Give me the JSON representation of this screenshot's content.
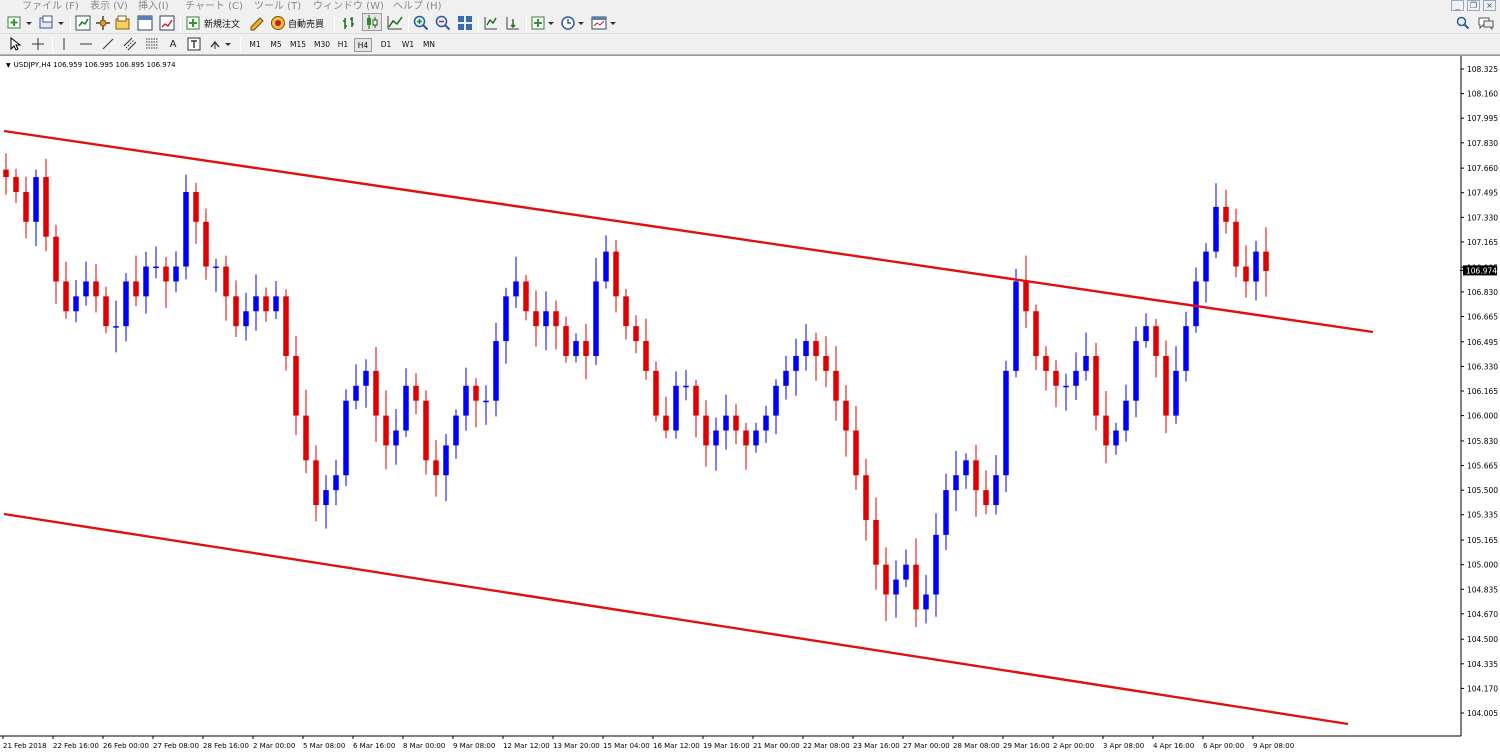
{
  "menu": {
    "items": [
      "ファイル (F)",
      "表示 (V)",
      "挿入(I)",
      "チャート (C)",
      "ツール (T)",
      "ウィンドウ (W)",
      "ヘルプ (H)"
    ]
  },
  "window_controls": [
    "_",
    "❐",
    "×"
  ],
  "toolbar": {
    "new_order_label": "新規注文",
    "auto_trading_label": "自動売買",
    "icons": [
      "new-chart-icon",
      "profiles-icon",
      "market-watch-icon",
      "navigator-icon",
      "data-window-icon",
      "terminal-icon",
      "strategy-tester-icon",
      "new-order-icon",
      "metaeditor-icon",
      "auto-trading-icon",
      "bar-chart-icon",
      "candlestick-icon",
      "line-chart-icon",
      "zoom-in-icon",
      "zoom-out-icon",
      "tile-windows-icon",
      "chart-shift-icon",
      "autoscroll-icon",
      "indicators-icon",
      "periods-icon",
      "templates-icon",
      "search-icon",
      "chat-icon"
    ]
  },
  "drawing_tools": {
    "icons": [
      "cursor-icon",
      "crosshair-icon",
      "vertical-line-icon",
      "horizontal-line-icon",
      "trendline-icon",
      "equidistant-channel-icon",
      "fibonacci-icon",
      "text-icon",
      "text-label-icon",
      "arrows-icon"
    ],
    "text_tool_label": "A"
  },
  "timeframes": {
    "items": [
      "M1",
      "M5",
      "M15",
      "M30",
      "H1",
      "H4",
      "D1",
      "W1",
      "MN"
    ],
    "active": "H4"
  },
  "chart_data": {
    "type": "candlestick",
    "symbol": "USDJPY,H4",
    "header": "USDJPY,H4  106.959 106.995 106.895 106.974",
    "ohlc": {
      "open": "106.959",
      "high": "106.995",
      "low": "106.895",
      "close": "106.974"
    },
    "current_price_label": "106.974",
    "price_ticks": [
      "108.325",
      "108.160",
      "107.995",
      "107.830",
      "107.660",
      "107.495",
      "107.330",
      "107.165",
      "106.995",
      "106.830",
      "106.665",
      "106.495",
      "106.330",
      "106.165",
      "106.000",
      "105.830",
      "105.665",
      "105.500",
      "105.335",
      "105.165",
      "105.000",
      "104.835",
      "104.670",
      "104.500",
      "104.335",
      "104.170",
      "104.005"
    ],
    "time_ticks": [
      "21 Feb 2018",
      "22 Feb 16:00",
      "26 Feb 00:00",
      "27 Feb 08:00",
      "28 Feb 16:00",
      "2 Mar 00:00",
      "5 Mar 08:00",
      "6 Mar 16:00",
      "8 Mar 00:00",
      "9 Mar 08:00",
      "12 Mar 12:00",
      "13 Mar 20:00",
      "15 Mar 04:00",
      "16 Mar 12:00",
      "19 Mar 16:00",
      "21 Mar 00:00",
      "22 Mar 08:00",
      "23 Mar 16:00",
      "27 Mar 00:00",
      "28 Mar 08:00",
      "29 Mar 16:00",
      "2 Apr 00:00",
      "3 Apr 08:00",
      "4 Apr 16:00",
      "6 Apr 00:00",
      "9 Apr 08:00"
    ],
    "ylim": [
      104.005,
      108.325
    ],
    "bull_color": "#0000ff",
    "bear_color": "#e00000",
    "channel_color": "#e01010",
    "close_path": [
      107.6,
      107.5,
      107.3,
      107.6,
      107.2,
      106.9,
      106.7,
      106.8,
      106.9,
      106.8,
      106.6,
      106.6,
      106.9,
      106.8,
      107.0,
      107.0,
      106.9,
      107.0,
      107.5,
      107.3,
      107.0,
      107.0,
      106.8,
      106.6,
      106.7,
      106.8,
      106.7,
      106.8,
      106.4,
      106.0,
      105.7,
      105.4,
      105.5,
      105.6,
      106.1,
      106.2,
      106.3,
      106.0,
      105.8,
      105.9,
      106.2,
      106.1,
      105.7,
      105.6,
      105.8,
      106.0,
      106.2,
      106.1,
      106.1,
      106.5,
      106.8,
      106.9,
      106.7,
      106.6,
      106.7,
      106.6,
      106.4,
      106.5,
      106.4,
      106.9,
      107.1,
      106.8,
      106.6,
      106.5,
      106.3,
      106.0,
      105.9,
      106.2,
      106.2,
      106.0,
      105.8,
      105.9,
      106.0,
      105.9,
      105.8,
      105.9,
      106.0,
      106.2,
      106.3,
      106.4,
      106.5,
      106.4,
      106.3,
      106.1,
      105.9,
      105.6,
      105.3,
      105.0,
      104.8,
      104.9,
      105.0,
      104.7,
      104.8,
      105.2,
      105.5,
      105.6,
      105.7,
      105.5,
      105.4,
      105.6,
      106.3,
      106.9,
      106.7,
      106.4,
      106.3,
      106.2,
      106.2,
      106.3,
      106.4,
      106.0,
      105.8,
      105.9,
      106.1,
      106.5,
      106.6,
      106.4,
      106.0,
      106.3,
      106.6,
      106.9,
      107.1,
      107.4,
      107.3,
      107.0,
      106.9,
      107.1,
      106.97
    ]
  }
}
